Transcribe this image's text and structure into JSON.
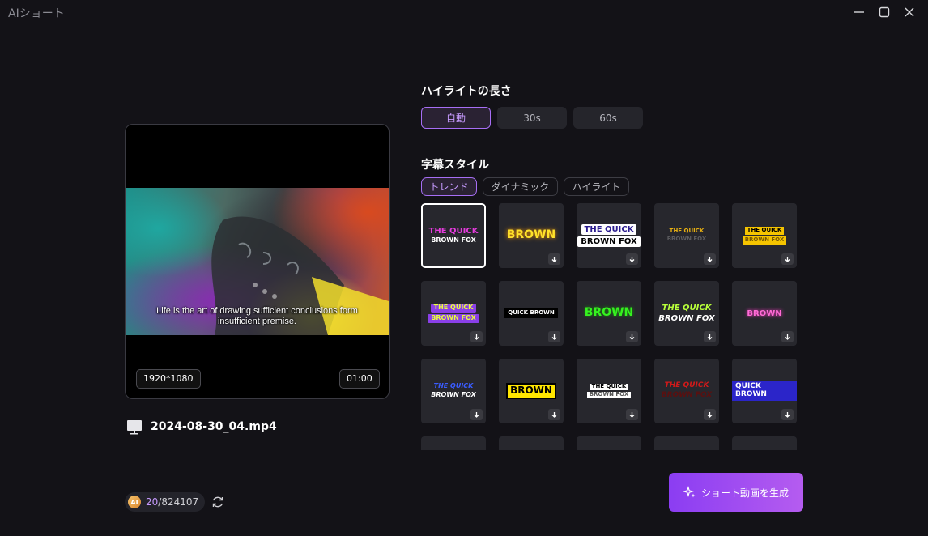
{
  "app": {
    "title": "AIショート"
  },
  "preview": {
    "subtitle_line1": "Life is the art of drawing sufficient conclusions form",
    "subtitle_line2": "insufficient premise.",
    "resolution": "1920*1080",
    "duration": "01:00",
    "file_name": "2024-08-30_04.mp4"
  },
  "credits": {
    "badge": "AI",
    "used": "20",
    "total": "/824107"
  },
  "highlight_length": {
    "title": "ハイライトの長さ",
    "options": [
      "自動",
      "30s",
      "60s"
    ],
    "selected": "自動"
  },
  "subtitle_style": {
    "title": "字幕スタイル",
    "tabs": [
      "トレンド",
      "ダイナミック",
      "ハイライト"
    ],
    "selected_tab": "トレンド",
    "tiles": [
      {
        "l1": "THE QUICK",
        "l2": "BROWN FOX",
        "selected": true
      },
      {
        "l1": "BROWN",
        "l2": ""
      },
      {
        "l1": "THE QUICK",
        "l2": "BROWN FOX"
      },
      {
        "l1": "THE QUICK",
        "l2": "BROWN FOX"
      },
      {
        "l1": "THE QUICK",
        "l2": "BROWN FOX"
      },
      {
        "l1": "THE QUICK",
        "l2": "BROWN FOX"
      },
      {
        "l1": "QUICK BROWN",
        "l2": ""
      },
      {
        "l1": "BROWN",
        "l2": ""
      },
      {
        "l1": "THE QUICK",
        "l2": "BROWN FOX"
      },
      {
        "l1": "BROWN",
        "l2": ""
      },
      {
        "l1": "THE QUICK",
        "l2": "BROWN FOX"
      },
      {
        "l1": "BROWN",
        "l2": ""
      },
      {
        "l1": "THE QUICK",
        "l2": "BROWN FOX"
      },
      {
        "l1": "THE QUICK",
        "l2": "BROWN FOX"
      },
      {
        "l1": "QUICK BROWN",
        "l2": ""
      }
    ]
  },
  "generate_button": {
    "label": "ショート動画を生成"
  },
  "colors": {
    "accent": "#a76ef5",
    "background": "#131217",
    "tile": "#27272d"
  }
}
